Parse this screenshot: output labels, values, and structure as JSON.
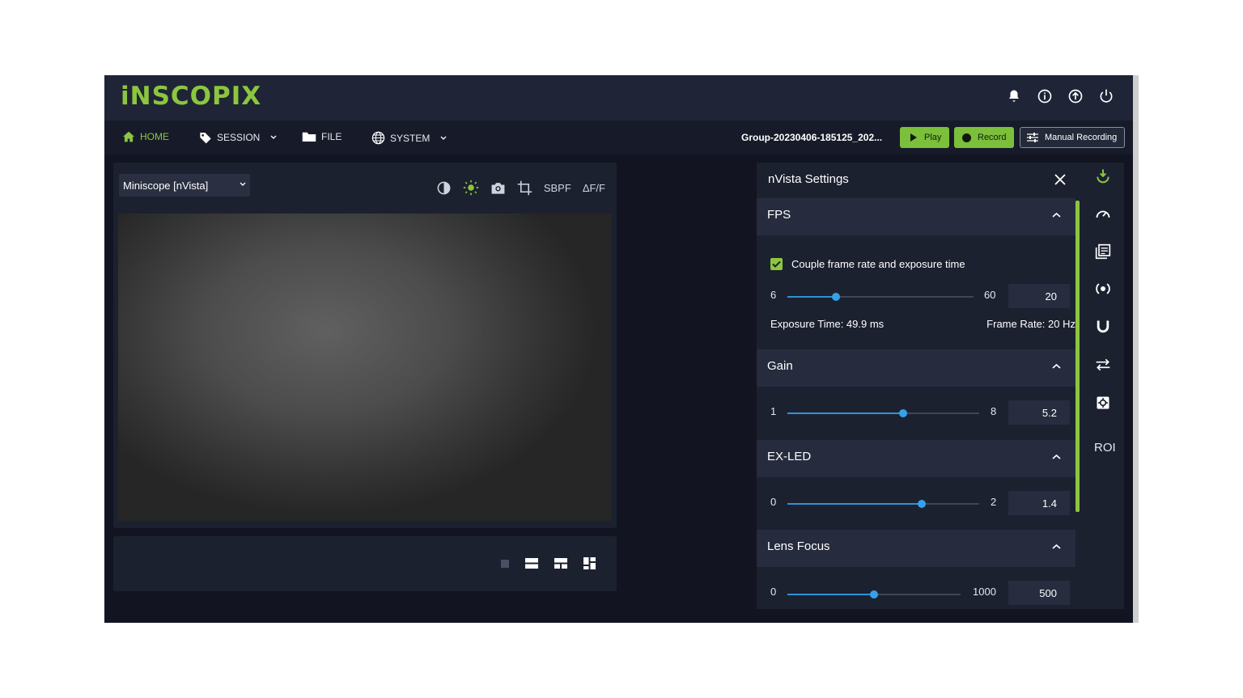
{
  "header": {
    "logo_text": "iNSCOPIX",
    "icons": [
      "bell-icon",
      "info-icon",
      "upload-icon",
      "power-icon"
    ]
  },
  "nav": {
    "home": "HOME",
    "session": "SESSION",
    "file": "FILE",
    "system": "SYSTEM",
    "session_name": "Group-20230406-185125_202...",
    "play_label": "Play",
    "record_label": "Record",
    "manual_label": "Manual Recording"
  },
  "viewer": {
    "source_select": "Miniscope [nVista]",
    "tools": {
      "sbpf": "SBPF",
      "dff": "ΔF/F"
    }
  },
  "settings": {
    "title": "nVista Settings",
    "fps": {
      "title": "FPS",
      "couple_label": "Couple frame rate and exposure time",
      "couple_checked": true,
      "min": "6",
      "max": "60",
      "value": "20",
      "exposure_text": "Exposure Time: 49.9 ms",
      "frame_rate_text": "Frame Rate: 20 Hz"
    },
    "gain": {
      "title": "Gain",
      "min": "1",
      "max": "8",
      "value": "5.2"
    },
    "exled": {
      "title": "EX-LED",
      "min": "0",
      "max": "2",
      "value": "1.4"
    },
    "focus": {
      "title": "Lens Focus",
      "min": "0",
      "max": "1000",
      "value": "500"
    }
  },
  "rail": {
    "roi_label": "ROI"
  },
  "colors": {
    "accent_green": "#8cc63f",
    "slider_blue": "#34a2ea",
    "background": "#121521"
  }
}
